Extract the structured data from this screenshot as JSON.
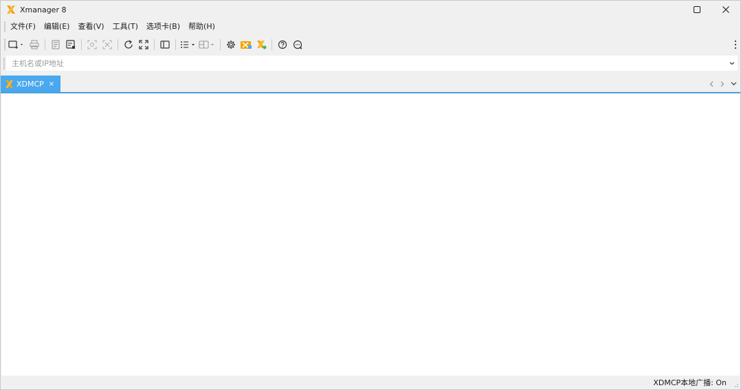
{
  "titlebar": {
    "title": "Xmanager 8",
    "brand_color": "#f5a300"
  },
  "window_controls": {
    "maximize_icon": "maximize-icon",
    "close_icon": "close-icon"
  },
  "menu": {
    "items": [
      {
        "label": "文件(F)"
      },
      {
        "label": "编辑(E)"
      },
      {
        "label": "查看(V)"
      },
      {
        "label": "工具(T)"
      },
      {
        "label": "选项卡(B)"
      },
      {
        "label": "帮助(H)"
      }
    ]
  },
  "toolbar": {
    "buttons": [
      "new-session-icon",
      "print-icon",
      "properties-icon",
      "session-manager-icon",
      "zoom-in-icon",
      "zoom-fit-icon",
      "refresh-icon",
      "fullscreen-icon",
      "panel-icon",
      "list-view-icon",
      "layout-icon",
      "settings-icon",
      "xmanager-icon",
      "xstart-icon",
      "help-icon",
      "chat-icon"
    ]
  },
  "address": {
    "placeholder": "主机名或IP地址",
    "value": ""
  },
  "tabs": {
    "active": {
      "label": "XDMCP",
      "close_symbol": "×"
    },
    "accent_color": "#4aa8ee"
  },
  "status": {
    "text": "XDMCP本地广播: On"
  }
}
